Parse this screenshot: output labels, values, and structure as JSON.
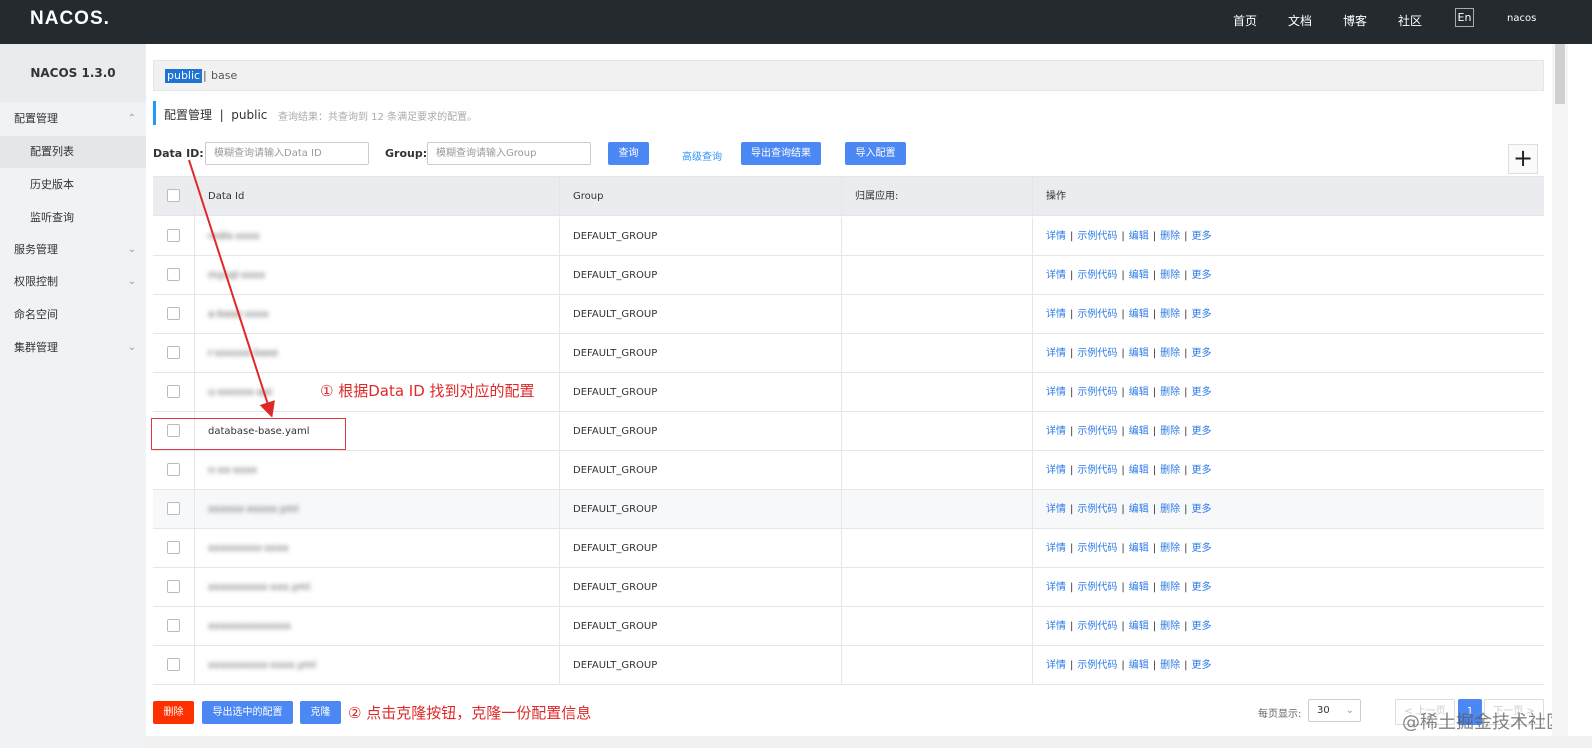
{
  "header": {
    "logo": "NACOS.",
    "nav": [
      "首页",
      "文档",
      "博客",
      "社区"
    ],
    "lang": "En",
    "user": "nacos"
  },
  "sidebar": {
    "version": "NACOS 1.3.0",
    "items": [
      {
        "label": "配置管理",
        "arrow": "^"
      },
      {
        "label": "配置列表"
      },
      {
        "label": "历史版本"
      },
      {
        "label": "监听查询"
      },
      {
        "label": "服务管理",
        "arrow": "v"
      },
      {
        "label": "权限控制",
        "arrow": "v"
      },
      {
        "label": "命名空间"
      },
      {
        "label": "集群管理",
        "arrow": "v"
      }
    ]
  },
  "namespace": {
    "active": "public",
    "separator": "|",
    "other": "base"
  },
  "page": {
    "title": "配置管理  |  public",
    "query_note": "查询结果：共查询到 12 条满足要求的配置。"
  },
  "search": {
    "data_id_label": "Data ID:",
    "data_id_placeholder": "模糊查询请输入Data ID",
    "group_label": "Group:",
    "group_placeholder": "模糊查询请输入Group",
    "query_button": "查询",
    "advanced_link": "高级查询",
    "export_button": "导出查询结果",
    "import_button": "导入配置",
    "add_button": "+"
  },
  "table": {
    "headers": [
      "Data Id",
      "Group",
      "归属应用:",
      "操作"
    ],
    "ops": [
      "详情",
      "示例代码",
      "编辑",
      "删除",
      "更多"
    ],
    "rows": [
      {
        "data_id": "redis-xxxx",
        "group": "DEFAULT_GROUP",
        "app": "",
        "blurred": true
      },
      {
        "data_id": "mysql-xxxx",
        "group": "DEFAULT_GROUP",
        "app": "",
        "blurred": true
      },
      {
        "data_id": "a-base-xxxx",
        "group": "DEFAULT_GROUP",
        "app": "",
        "blurred": true
      },
      {
        "data_id": "r-xxxxxx-base",
        "group": "DEFAULT_GROUP",
        "app": "",
        "blurred": true
      },
      {
        "data_id": "u-xxxxxx-api",
        "group": "DEFAULT_GROUP",
        "app": "",
        "blurred": true
      },
      {
        "data_id": "database-base.yaml",
        "group": "DEFAULT_GROUP",
        "app": "",
        "blurred": false
      },
      {
        "data_id": "n-xx-xxxx",
        "group": "DEFAULT_GROUP",
        "app": "",
        "blurred": true
      },
      {
        "data_id": "xxxxxx-xxxxx.yml",
        "group": "DEFAULT_GROUP",
        "app": "",
        "blurred": true
      },
      {
        "data_id": "xxxxxxxxx-xxxx",
        "group": "DEFAULT_GROUP",
        "app": "",
        "blurred": true
      },
      {
        "data_id": "xxxxxxxxxx-xxx.yml",
        "group": "DEFAULT_GROUP",
        "app": "",
        "blurred": true
      },
      {
        "data_id": "xxxxxxxxxxxxxx",
        "group": "DEFAULT_GROUP",
        "app": "",
        "blurred": true
      },
      {
        "data_id": "xxxxxxxxxx-xxxx.yml",
        "group": "DEFAULT_GROUP",
        "app": "",
        "blurred": true
      }
    ]
  },
  "annotations": {
    "step1": "① 根据Data ID 找到对应的配置",
    "step2": "② 点击克隆按钮，克隆一份配置信息"
  },
  "footer": {
    "delete_button": "删除",
    "export_selected_button": "导出选中的配置",
    "clone_button": "克隆",
    "page_size_label": "每页显示:",
    "page_size": "30",
    "prev": "< 上一页",
    "current_page": "1",
    "next": "下一页 >",
    "watermark": "@稀土掘金技术社区"
  },
  "colors": {
    "topbar": "#252a2f",
    "primary": "#4c88f4",
    "danger": "#ff3000",
    "annotation": "#e02828",
    "link": "#2e7be6"
  }
}
